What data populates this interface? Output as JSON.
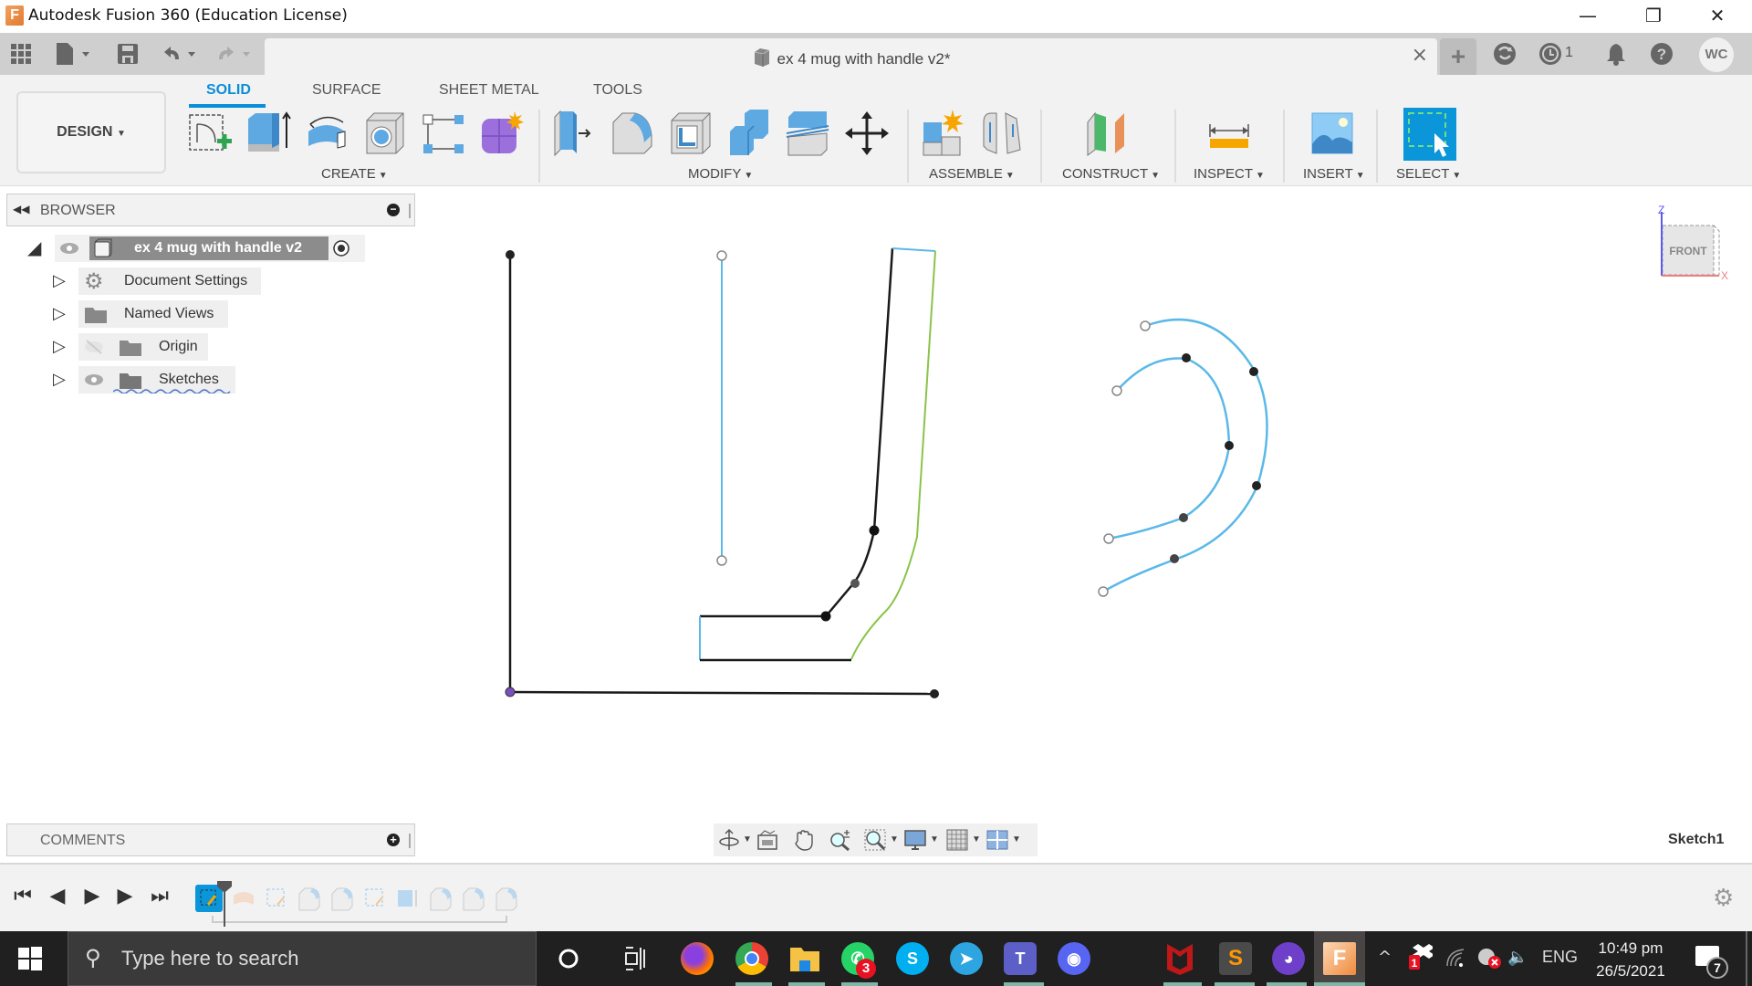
{
  "window": {
    "title": "Autodesk Fusion 360 (Education License)",
    "app_icon": "fusion-360-icon",
    "controls": {
      "minimize": "—",
      "restore": "❐",
      "close": "✕"
    }
  },
  "appbar": {
    "quick_access": [
      {
        "name": "data-panel-grid-icon",
        "glyph": "▦"
      },
      {
        "name": "file-menu-icon",
        "glyph": "▮▾"
      },
      {
        "name": "save-icon",
        "glyph": "💾"
      },
      {
        "name": "undo-icon",
        "glyph": "↶▾"
      },
      {
        "name": "redo-icon",
        "glyph": "↷▾"
      }
    ],
    "document_tab": {
      "title": "ex 4 mug with handle v2*",
      "close": "×"
    },
    "new_tab": "+",
    "right_icons": [
      {
        "name": "extensions-icon",
        "glyph": "⟳"
      },
      {
        "name": "job-status-icon",
        "glyph": "◷",
        "count": "1"
      },
      {
        "name": "notifications-icon",
        "glyph": "🔔"
      },
      {
        "name": "help-icon",
        "glyph": "?"
      }
    ],
    "user_initials": "WC"
  },
  "ribbon": {
    "workspace": "DESIGN",
    "tabs": [
      {
        "label": "SOLID",
        "active": true
      },
      {
        "label": "SURFACE",
        "active": false
      },
      {
        "label": "SHEET METAL",
        "active": false
      },
      {
        "label": "TOOLS",
        "active": false
      }
    ],
    "groups": [
      {
        "label": "CREATE",
        "tools": [
          "create-sketch",
          "extrude",
          "revolve",
          "hole",
          "pattern",
          "form"
        ]
      },
      {
        "label": "MODIFY",
        "tools": [
          "press-pull",
          "fillet",
          "shell",
          "combine",
          "split-body",
          "move-copy"
        ]
      },
      {
        "label": "ASSEMBLE",
        "tools": [
          "new-component",
          "joint"
        ]
      },
      {
        "label": "CONSTRUCT",
        "tools": [
          "offset-plane"
        ]
      },
      {
        "label": "INSPECT",
        "tools": [
          "measure"
        ]
      },
      {
        "label": "INSERT",
        "tools": [
          "insert-image"
        ]
      },
      {
        "label": "SELECT",
        "tools": [
          "window-select"
        ]
      }
    ]
  },
  "browser": {
    "title": "BROWSER",
    "root": {
      "label": "ex 4 mug with handle v2"
    },
    "items": [
      {
        "label": "Document Settings",
        "icon": "gear-icon"
      },
      {
        "label": "Named Views",
        "icon": "folder-icon"
      },
      {
        "label": "Origin",
        "icon": "folder-icon",
        "hidden": true
      },
      {
        "label": "Sketches",
        "icon": "folder-icon",
        "visible": true
      }
    ]
  },
  "viewcube": {
    "face": "FRONT",
    "axis_z": "Z",
    "axis_x": "X"
  },
  "comments": {
    "title": "COMMENTS"
  },
  "navbar": {
    "tools": [
      "orbit",
      "look-at",
      "pan",
      "zoom",
      "fit",
      "display-settings",
      "grid-settings",
      "viewports"
    ]
  },
  "status": {
    "active_sketch": "Sketch1"
  },
  "timeline": {
    "controls": [
      "go-to-start",
      "step-back",
      "play",
      "step-forward",
      "go-to-end"
    ],
    "features": [
      "sketch",
      "revolve",
      "sketch",
      "fillet",
      "fillet",
      "sketch",
      "extrude",
      "fillet",
      "fillet",
      "fillet"
    ],
    "marker_position": 1
  },
  "taskbar": {
    "search_placeholder": "Type here to search",
    "apps": [
      {
        "name": "cortana",
        "glyph": "○",
        "color": "#202020"
      },
      {
        "name": "task-view",
        "glyph": "⧉",
        "color": "#202020"
      },
      {
        "name": "firefox",
        "glyph": "🦊",
        "color": "#e66000"
      },
      {
        "name": "chrome",
        "glyph": "●",
        "color": "#34a853"
      },
      {
        "name": "file-explorer",
        "glyph": "▬",
        "color": "#f6c244"
      },
      {
        "name": "whatsapp",
        "glyph": "✆",
        "color": "#25d366",
        "badge": "3"
      },
      {
        "name": "skype",
        "glyph": "S",
        "color": "#00aff0"
      },
      {
        "name": "telegram",
        "glyph": "➤",
        "color": "#2ca5e0"
      },
      {
        "name": "teams",
        "glyph": "T",
        "color": "#5b5fc7"
      },
      {
        "name": "discord",
        "glyph": "◉",
        "color": "#5865f2"
      },
      {
        "name": "mcafee",
        "glyph": "M",
        "color": "#c01818"
      },
      {
        "name": "sublime-text",
        "glyph": "S",
        "color": "#ff9800"
      },
      {
        "name": "github-desktop",
        "glyph": "◕",
        "color": "#6e40c9"
      },
      {
        "name": "fusion-360",
        "glyph": "F",
        "color": "#f08a3c"
      }
    ],
    "tray": {
      "show_hidden": "^",
      "dropbox_badge": "1",
      "language": "ENG",
      "time": "10:49 pm",
      "date": "26/5/2021",
      "notification_count": "7"
    }
  }
}
